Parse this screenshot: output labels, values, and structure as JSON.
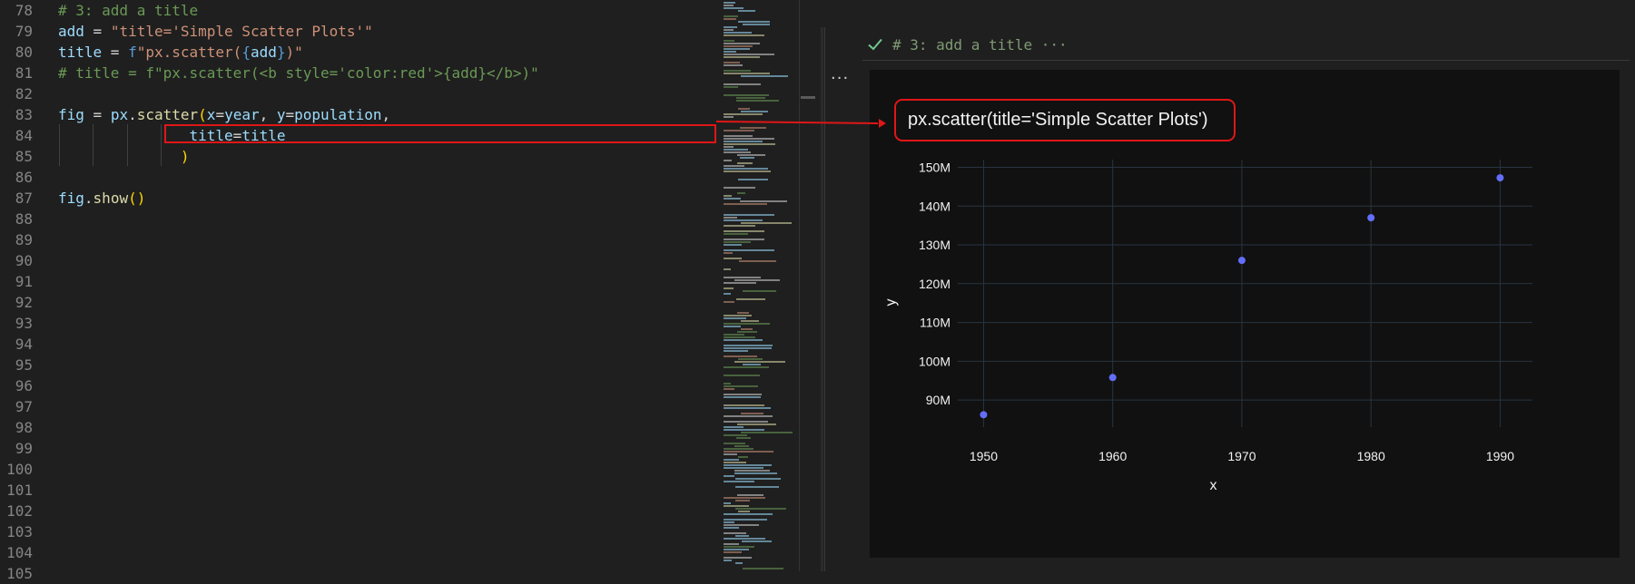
{
  "editor": {
    "lines": [
      {
        "n": "78",
        "tokens": [
          {
            "t": "# 3: add a title",
            "c": "com"
          }
        ]
      },
      {
        "n": "79",
        "tokens": [
          {
            "t": "add",
            "c": "var"
          },
          {
            "t": " = ",
            "c": "op"
          },
          {
            "t": "\"title='Simple Scatter Plots'\"",
            "c": "str"
          }
        ]
      },
      {
        "n": "80",
        "tokens": [
          {
            "t": "title",
            "c": "var"
          },
          {
            "t": " = ",
            "c": "op"
          },
          {
            "t": "f",
            "c": "kw"
          },
          {
            "t": "\"px.scatter(",
            "c": "str"
          },
          {
            "t": "{",
            "c": "kw"
          },
          {
            "t": "add",
            "c": "var"
          },
          {
            "t": "}",
            "c": "kw"
          },
          {
            "t": ")\"",
            "c": "str"
          }
        ]
      },
      {
        "n": "81",
        "tokens": [
          {
            "t": "# title = f\"px.scatter(<b style='color:red'>{add}</b>)\"",
            "c": "com"
          }
        ]
      },
      {
        "n": "82",
        "tokens": []
      },
      {
        "n": "83",
        "tokens": [
          {
            "t": "fig",
            "c": "var"
          },
          {
            "t": " = ",
            "c": "op"
          },
          {
            "t": "px",
            "c": "var"
          },
          {
            "t": ".",
            "c": "op"
          },
          {
            "t": "scatter",
            "c": "fn"
          },
          {
            "t": "(",
            "c": "br1"
          },
          {
            "t": "x",
            "c": "var"
          },
          {
            "t": "=",
            "c": "op"
          },
          {
            "t": "year",
            "c": "var"
          },
          {
            "t": ", ",
            "c": "op"
          },
          {
            "t": "y",
            "c": "var"
          },
          {
            "t": "=",
            "c": "op"
          },
          {
            "t": "population",
            "c": "var"
          },
          {
            "t": ",",
            "c": "op"
          }
        ]
      },
      {
        "n": "84",
        "tokens": [
          {
            "t": "               ",
            "c": "op"
          },
          {
            "t": "title",
            "c": "var"
          },
          {
            "t": "=",
            "c": "op"
          },
          {
            "t": "title",
            "c": "var"
          }
        ]
      },
      {
        "n": "85",
        "tokens": [
          {
            "t": "              ",
            "c": "op"
          },
          {
            "t": ")",
            "c": "br1"
          }
        ]
      },
      {
        "n": "86",
        "tokens": []
      },
      {
        "n": "87",
        "tokens": [
          {
            "t": "fig",
            "c": "var"
          },
          {
            "t": ".",
            "c": "op"
          },
          {
            "t": "show",
            "c": "fn"
          },
          {
            "t": "()",
            "c": "br1"
          }
        ]
      },
      {
        "n": "88",
        "tokens": []
      },
      {
        "n": "89",
        "tokens": []
      },
      {
        "n": "90",
        "tokens": []
      },
      {
        "n": "91",
        "tokens": []
      },
      {
        "n": "92",
        "tokens": []
      },
      {
        "n": "93",
        "tokens": []
      },
      {
        "n": "94",
        "tokens": []
      },
      {
        "n": "95",
        "tokens": []
      },
      {
        "n": "96",
        "tokens": []
      },
      {
        "n": "97",
        "tokens": []
      },
      {
        "n": "98",
        "tokens": []
      },
      {
        "n": "99",
        "tokens": []
      },
      {
        "n": "100",
        "tokens": []
      },
      {
        "n": "101",
        "tokens": []
      },
      {
        "n": "102",
        "tokens": []
      },
      {
        "n": "103",
        "tokens": []
      },
      {
        "n": "104",
        "tokens": []
      },
      {
        "n": "105",
        "tokens": []
      }
    ]
  },
  "colors": {
    "com": "#6a9955",
    "var": "#9cdcfe",
    "op": "#d4d4d4",
    "str": "#ce9178",
    "fn": "#dcdcaa",
    "kw": "#569cd6",
    "br1": "#ffd700",
    "highlight": "#e01616",
    "marker": "#636efa",
    "grid": "#283442",
    "check": "#73c991"
  },
  "notebook": {
    "more_actions": "···",
    "cell_title": "# 3: add a title ···",
    "check_icon": "check-icon",
    "output_title": "px.scatter(title='Simple Scatter Plots')"
  },
  "chart_data": {
    "type": "scatter",
    "title": "px.scatter(title='Simple Scatter Plots')",
    "xlabel": "x",
    "ylabel": "y",
    "x": [
      1950,
      1960,
      1970,
      1980,
      1990
    ],
    "y": [
      86.2,
      95.8,
      126.0,
      137.0,
      147.3
    ],
    "y_units": "M",
    "xticks": [
      1950,
      1960,
      1970,
      1980,
      1990
    ],
    "yticks": [
      90,
      100,
      110,
      120,
      130,
      140,
      150
    ],
    "ytick_labels": [
      "90M",
      "100M",
      "110M",
      "120M",
      "130M",
      "140M",
      "150M"
    ],
    "xlim": [
      1948,
      1992.5
    ],
    "ylim": [
      83,
      152
    ],
    "grid": true,
    "theme": "dark"
  }
}
